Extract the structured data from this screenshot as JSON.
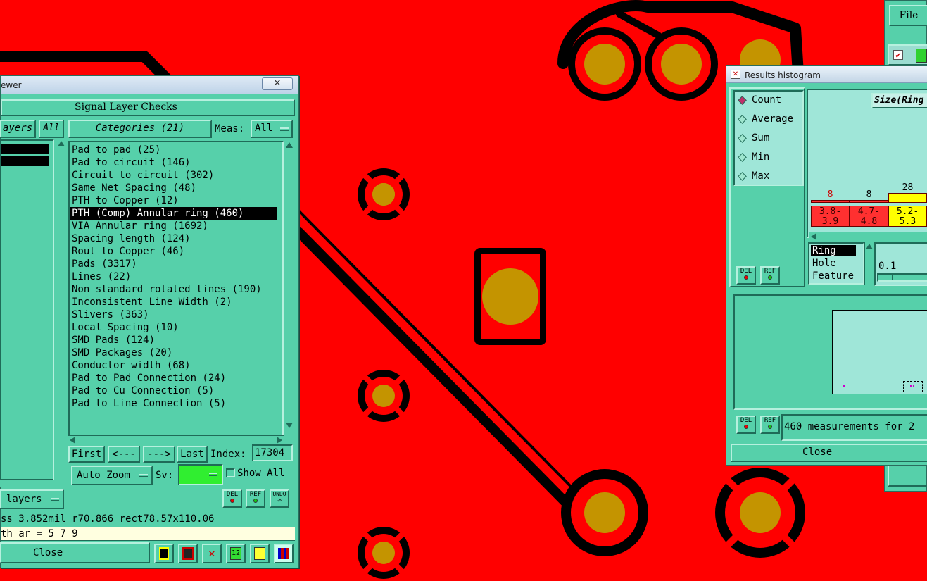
{
  "colors": {
    "board": "#ff0000",
    "copper": "#c49400",
    "void": "#000000",
    "panel": "#56d0aa"
  },
  "left_window": {
    "title": "ewer",
    "header": "Signal Layer Checks",
    "layers_label": "ayers",
    "all_button": "All",
    "categories_button": "Categories (21)",
    "meas_label": "Meas:",
    "meas_value": "All",
    "categories": [
      "Pad to pad (25)",
      "Pad to circuit (146)",
      "Circuit to circuit (302)",
      "Same Net Spacing (48)",
      "PTH to Copper (12)",
      "PTH (Comp) Annular ring (460)",
      "VIA Annular ring (1692)",
      "Spacing length (124)",
      "Rout to Copper (46)",
      "Pads (3317)",
      "Lines (22)",
      "Non standard rotated lines (190)",
      "Inconsistent Line Width (2)",
      "Slivers (363)",
      "Local Spacing (10)",
      "SMD Pads (124)",
      "SMD Packages (20)",
      "Conductor width (68)",
      "Pad to Pad Connection (24)",
      "Pad to Cu Connection (5)",
      "Pad to Line Connection (5)"
    ],
    "nav": {
      "first": "First",
      "prev": "<---",
      "next": "--->",
      "last": "Last",
      "index_label": "Index:",
      "index_value": "17304"
    },
    "auto_zoom": "Auto Zoom",
    "sv_label": "Sv:",
    "show_all": "Show All",
    "layers_bottom": "layers",
    "del": "DEL",
    "ref": "REF",
    "undo": "UNDO",
    "status1": "ss 3.852mil  r70.866  rect78.57x110.06",
    "status2": "th_ar = 5 7 9",
    "close": "Close"
  },
  "hist_window": {
    "title": "Results histogram",
    "modes": [
      "Count",
      "Average",
      "Sum",
      "Min",
      "Max"
    ],
    "selected_mode": "Count",
    "size_label": "Size(Ring",
    "bars": [
      {
        "count": "8",
        "range": "3.8-\n3.9",
        "color": "#ff3030"
      },
      {
        "count": "8",
        "range": "4.7-\n4.8",
        "color": "#ff3030"
      },
      {
        "count": "28",
        "range": "5.2-\n5.3",
        "color": "#ffff00"
      }
    ],
    "types": [
      "Ring",
      "Hole",
      "Feature"
    ],
    "slider_value": "0.1",
    "del": "DEL",
    "ref": "REF",
    "measurements": "460 measurements for 2",
    "close": "Close"
  },
  "file_window": {
    "file_menu": "File"
  }
}
